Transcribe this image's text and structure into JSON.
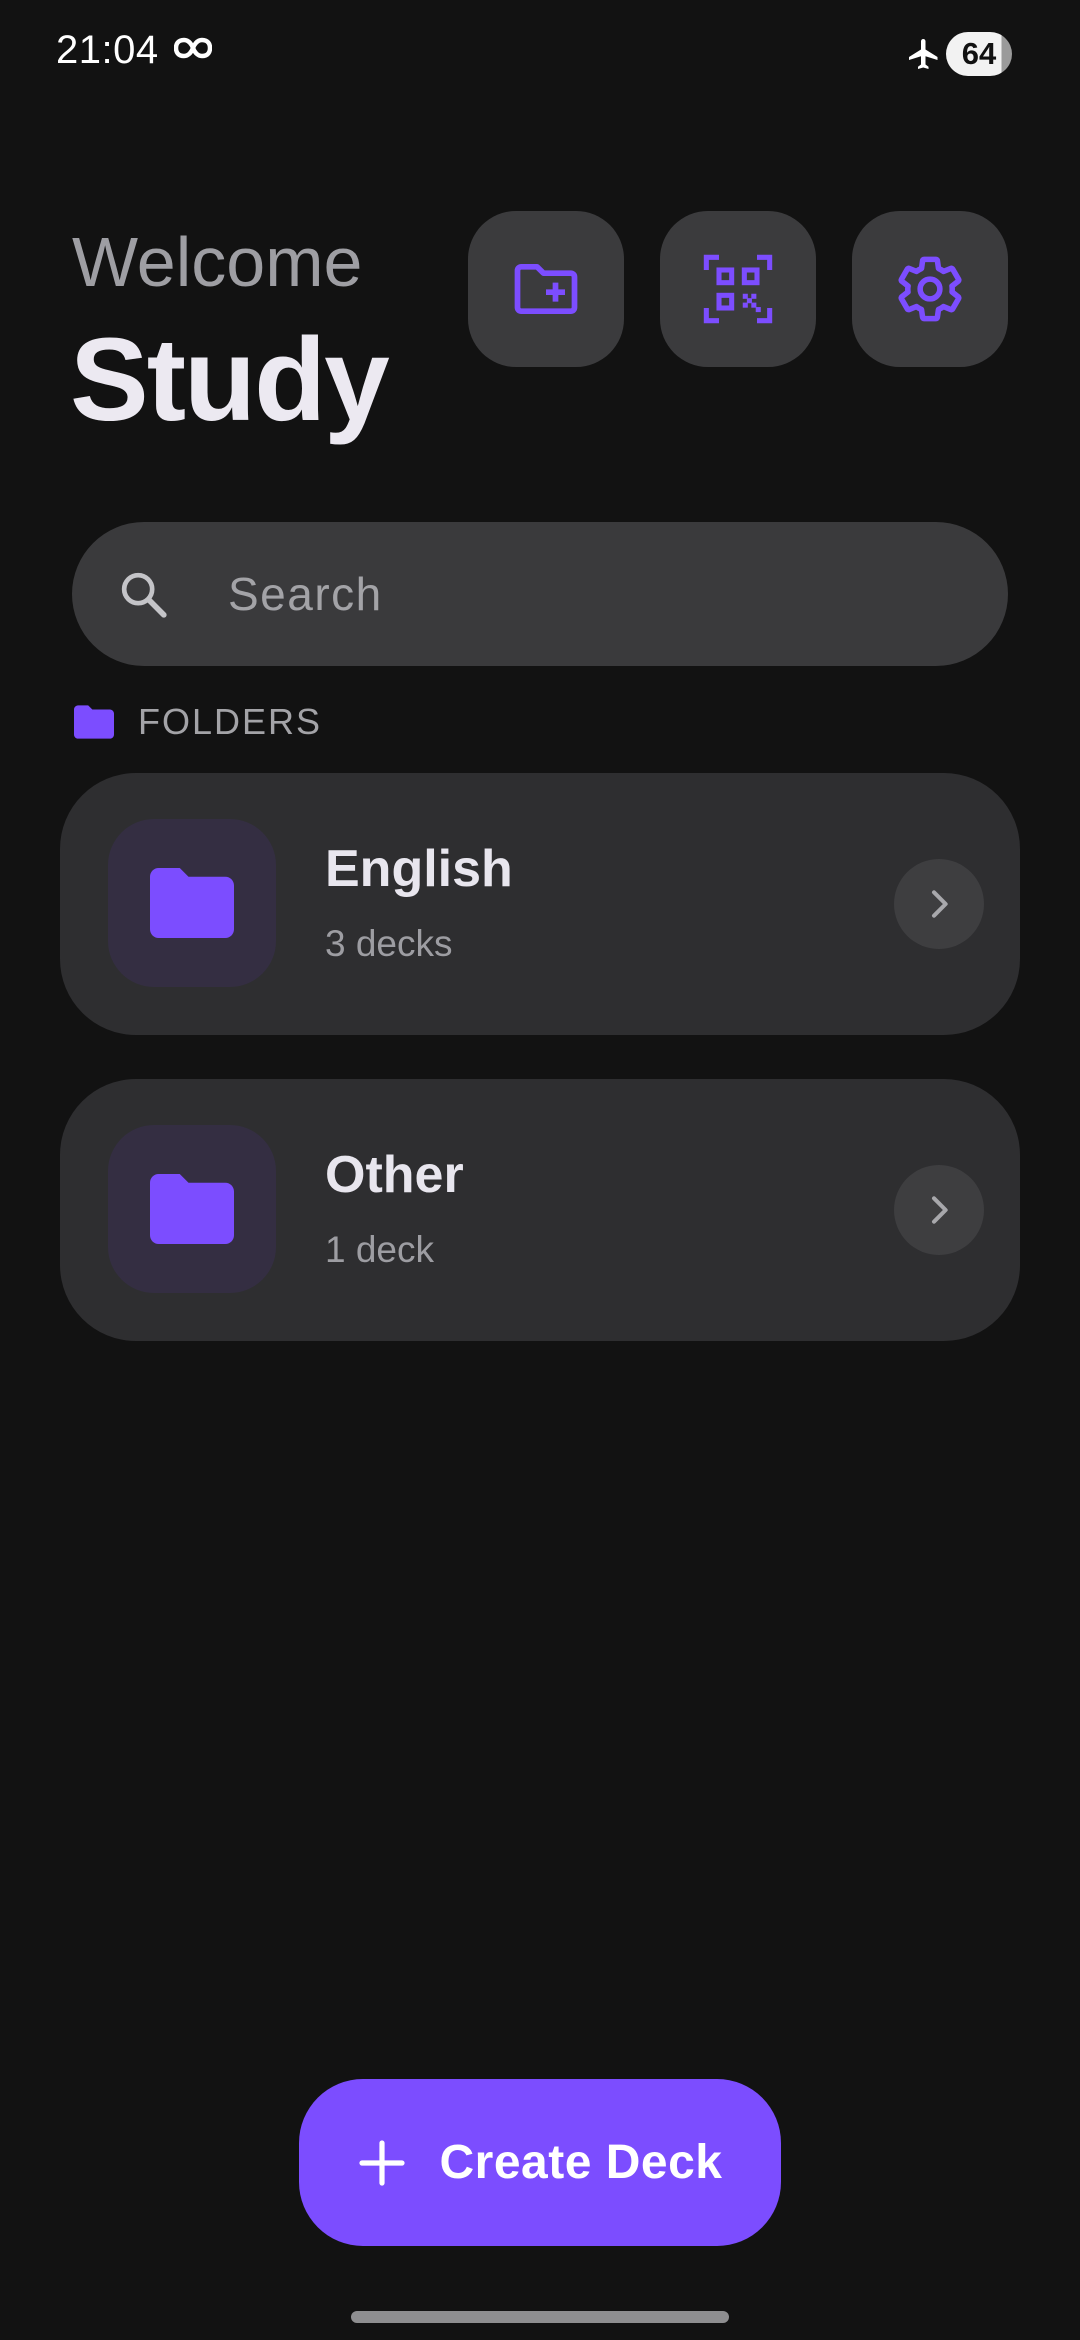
{
  "status_bar": {
    "time": "21:04",
    "battery": "64",
    "icons": [
      "infinity-icon",
      "airplane-icon"
    ]
  },
  "header": {
    "greeting": "Welcome",
    "title": "Study",
    "actions": [
      {
        "icon": "folder-add-icon"
      },
      {
        "icon": "qr-code-icon"
      },
      {
        "icon": "gear-icon"
      }
    ]
  },
  "search": {
    "placeholder": "Search",
    "value": ""
  },
  "folders_section": {
    "label": "FOLDERS",
    "icon": "folder-icon"
  },
  "folders": [
    {
      "name": "English",
      "count": "3 decks"
    },
    {
      "name": "Other",
      "count": "1 deck"
    }
  ],
  "fab": {
    "label": "Create Deck",
    "icon": "plus-icon"
  },
  "colors": {
    "background": "#121212",
    "accent": "#7c4dff",
    "card": "#2e2e30",
    "surface": "#3b3b3d"
  }
}
